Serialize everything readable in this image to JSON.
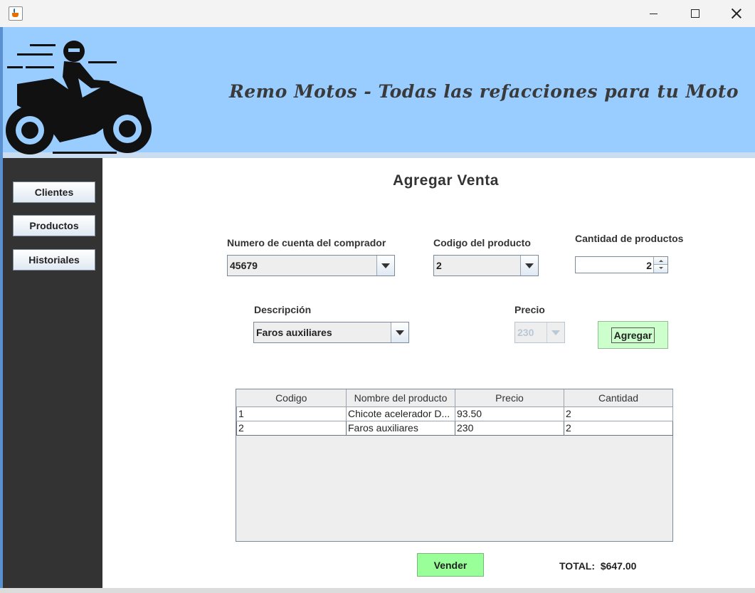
{
  "window": {
    "icon": "java-cup-icon",
    "controls": [
      "minimize-icon",
      "maximize-icon",
      "close-icon"
    ]
  },
  "banner": {
    "title": "Remo Motos - Todas las refacciones para tu Moto",
    "logo": "motorcycle-rider-logo"
  },
  "sidebar": {
    "items": [
      {
        "label": "Clientes"
      },
      {
        "label": "Productos"
      },
      {
        "label": "Historiales"
      }
    ]
  },
  "main": {
    "title": "Agregar Venta",
    "cuenta": {
      "label": "Numero de cuenta del comprador",
      "value": "45679"
    },
    "codigo": {
      "label": "Codigo del producto",
      "value": "2"
    },
    "cantidad": {
      "label": "Cantidad de productos",
      "value": "2"
    },
    "descripcion": {
      "label": "Descripción",
      "value": "Faros auxiliares"
    },
    "precio": {
      "label": "Precio",
      "value": "230",
      "enabled": false
    },
    "agregar_label": "Agregar",
    "vender_label": "Vender",
    "total_label": "TOTAL:",
    "total_value": "$647.00"
  },
  "table": {
    "columns": [
      "Codigo",
      "Nombre del producto",
      "Precio",
      "Cantidad"
    ],
    "rows": [
      [
        "1",
        "Chicote acelerador D...",
        "93.50",
        "2"
      ],
      [
        "2",
        "Faros auxiliares",
        "230",
        "2"
      ]
    ]
  },
  "colors": {
    "banner": "#99ccff",
    "sidebar": "#333333",
    "agregar_button": "#ccffcc",
    "vender_button": "#99ff99"
  }
}
